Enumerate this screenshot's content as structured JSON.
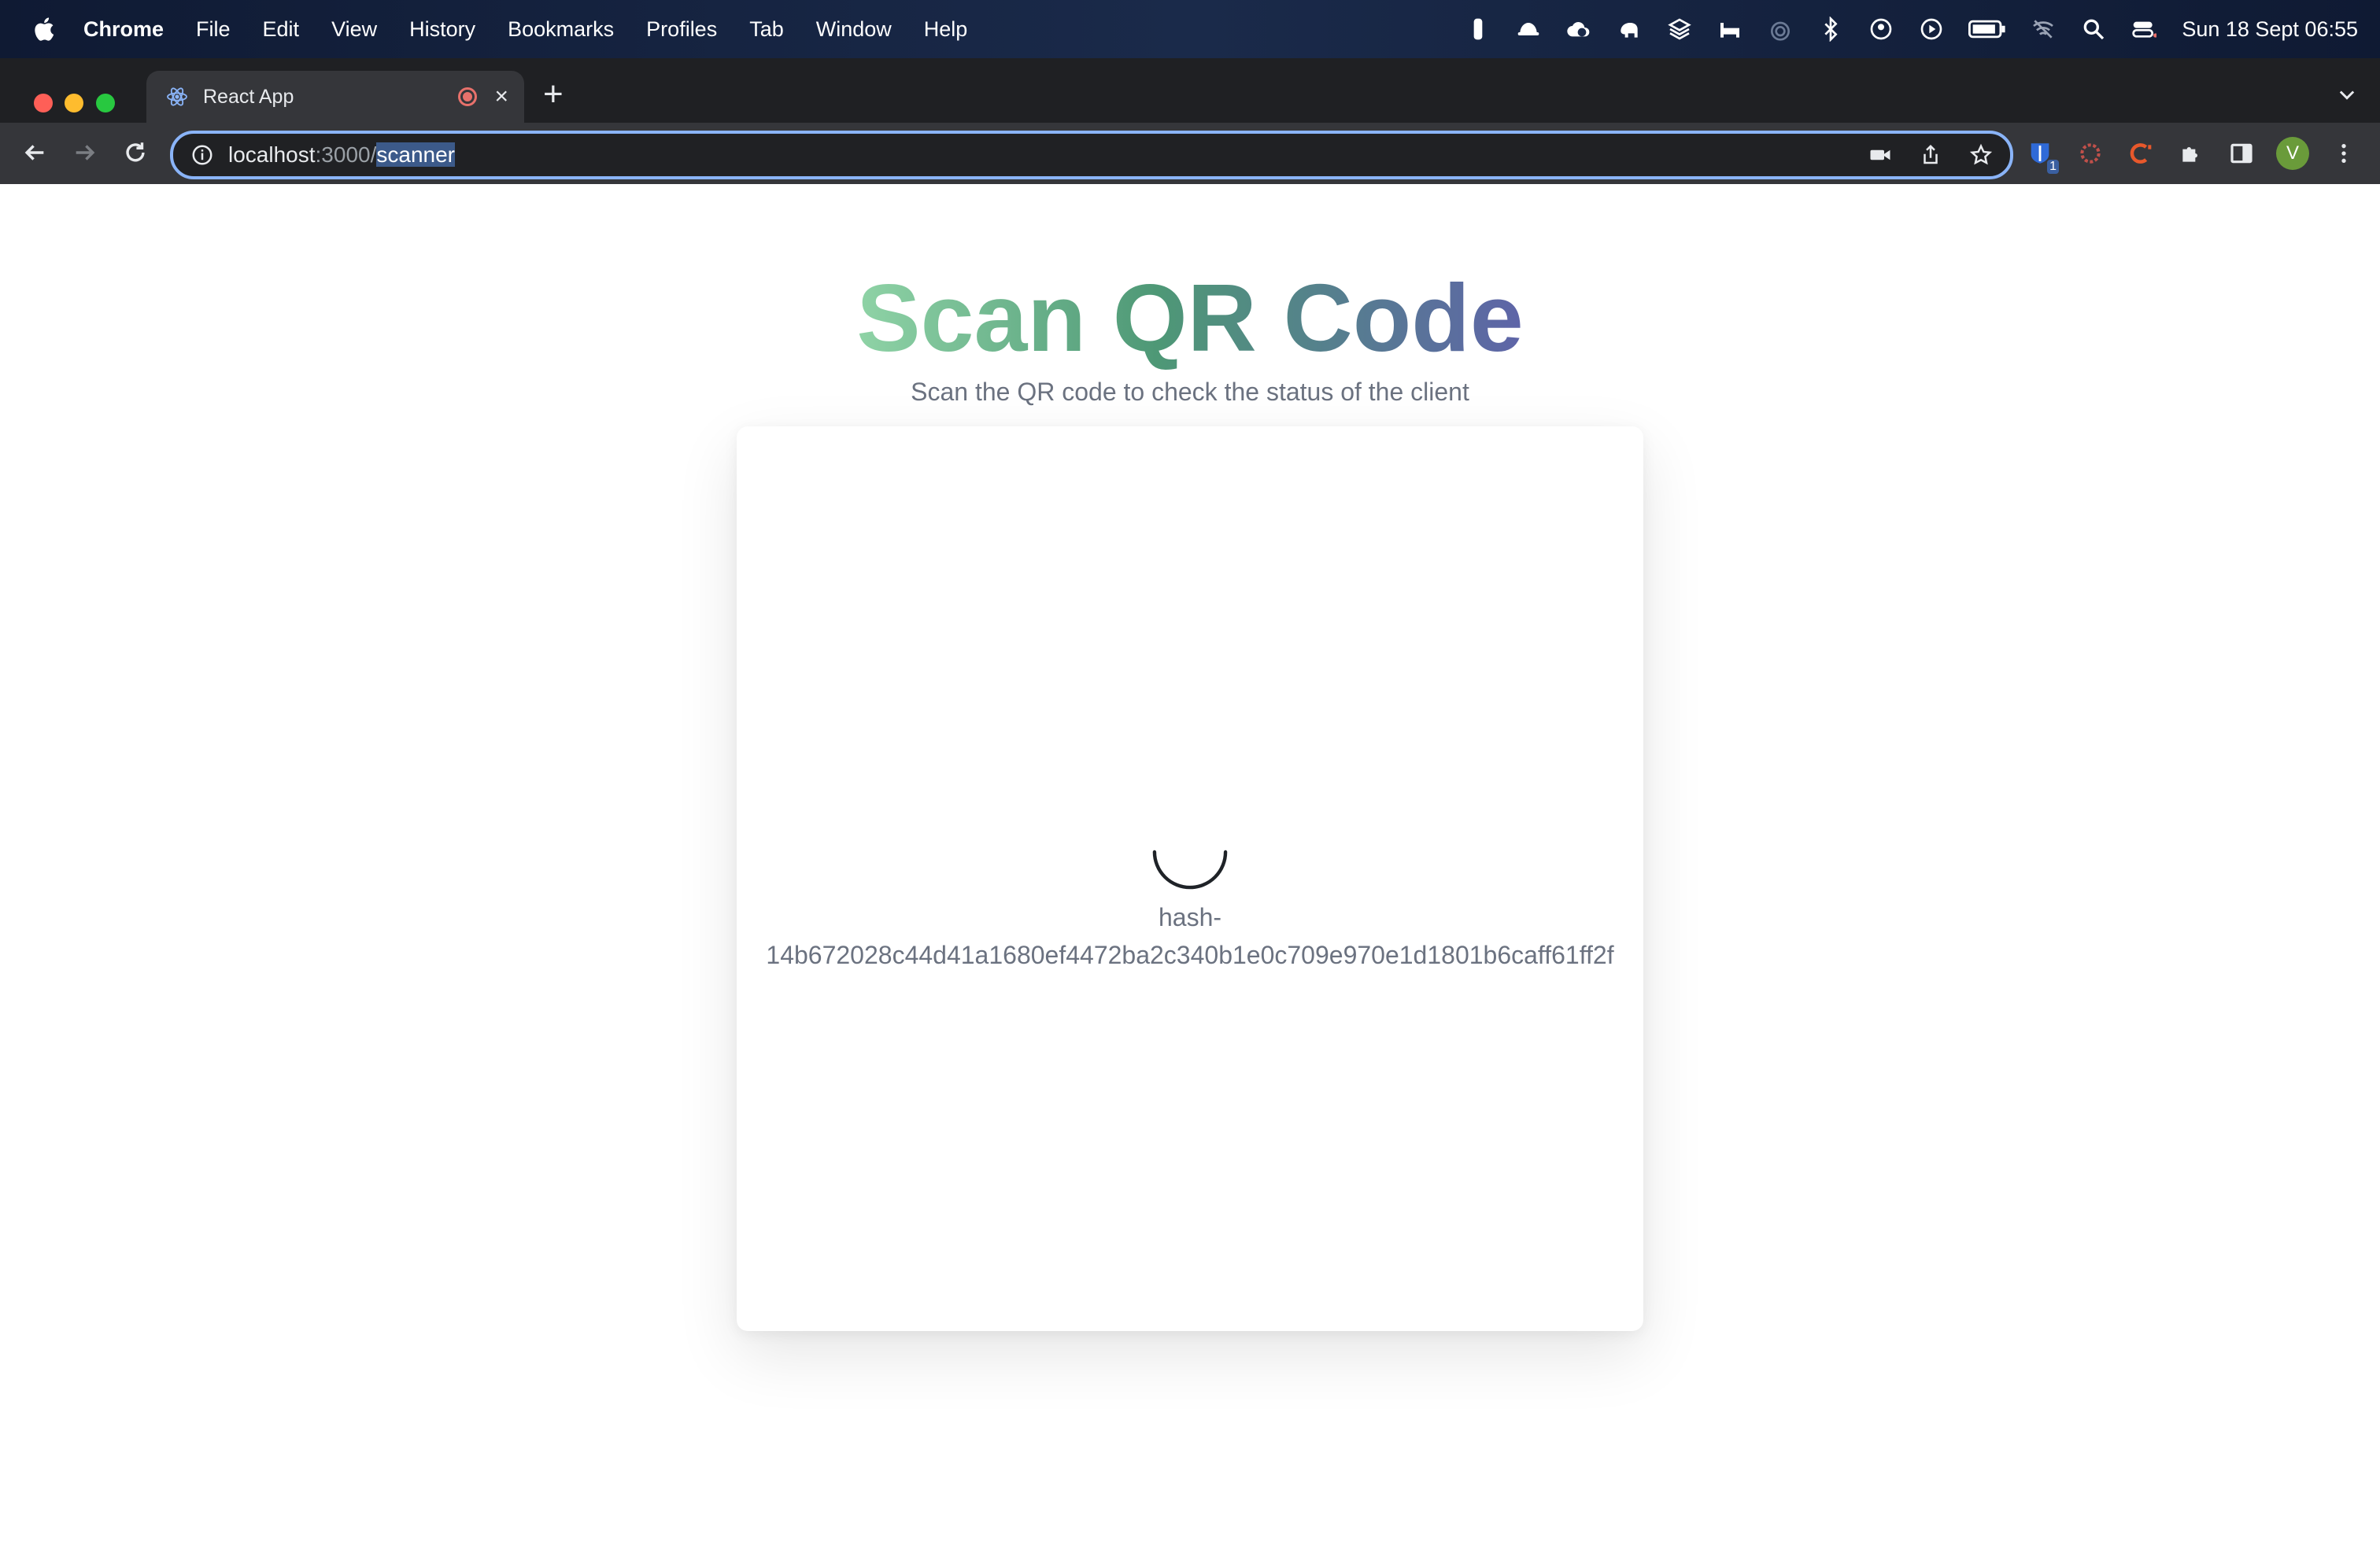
{
  "menubar": {
    "app": "Chrome",
    "items": [
      "File",
      "Edit",
      "View",
      "History",
      "Bookmarks",
      "Profiles",
      "Tab",
      "Window",
      "Help"
    ],
    "clock": "Sun 18 Sept  06:55"
  },
  "browser": {
    "tab_title": "React App",
    "url_host": "localhost",
    "url_port": ":3000/",
    "url_path": "scanner"
  },
  "profile": {
    "initial": "V"
  },
  "extensions": {
    "badge_count": "1"
  },
  "page": {
    "title": "Scan QR Code",
    "subtitle": "Scan the QR code to check the status of the client",
    "hash_line1": "hash-",
    "hash_line2": "14b672028c44d41a1680ef4472ba2c340b1e0c709e970e1d1801b6caff61ff2f"
  },
  "colors": {
    "title_gradient_start": "#8fd3a6",
    "title_gradient_mid": "#4e9876",
    "title_gradient_end": "#5e64a8",
    "omnibox_focus": "#8ab4f8",
    "profile_avatar": "#6a9b3a"
  }
}
